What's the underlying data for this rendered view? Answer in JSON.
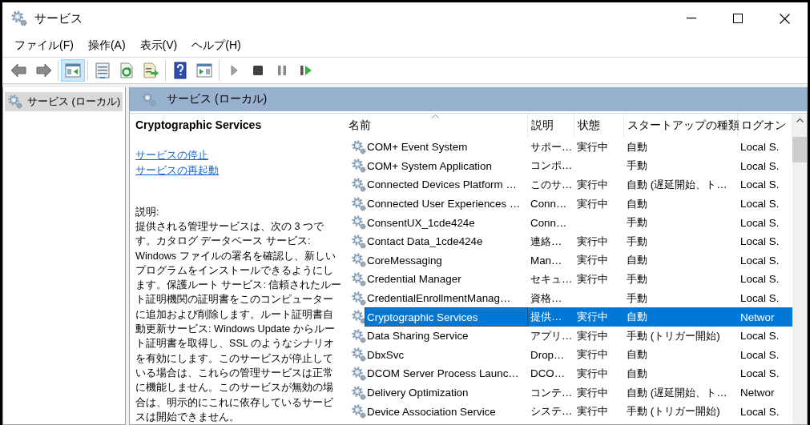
{
  "window": {
    "title": "サービス"
  },
  "menu": [
    {
      "label": "ファイル(F)"
    },
    {
      "label": "操作(A)"
    },
    {
      "label": "表示(V)"
    },
    {
      "label": "ヘルプ(H)"
    }
  ],
  "toolbar": [
    {
      "kind": "back",
      "pressed": false
    },
    {
      "kind": "forward",
      "pressed": false
    },
    {
      "kind": "sep"
    },
    {
      "kind": "tree",
      "pressed": true
    },
    {
      "kind": "sep"
    },
    {
      "kind": "properties",
      "pressed": false
    },
    {
      "kind": "refresh",
      "pressed": false
    },
    {
      "kind": "export",
      "pressed": false
    },
    {
      "kind": "sep"
    },
    {
      "kind": "help",
      "pressed": false
    },
    {
      "kind": "actionpane",
      "pressed": false
    },
    {
      "kind": "sep"
    },
    {
      "kind": "start",
      "pressed": false
    },
    {
      "kind": "stop",
      "pressed": false
    },
    {
      "kind": "pause",
      "pressed": false
    },
    {
      "kind": "resume",
      "pressed": false
    }
  ],
  "sidebar": {
    "items": [
      {
        "label": "サービス (ローカル)",
        "selected": true
      }
    ]
  },
  "panel": {
    "title": "サービス (ローカル)"
  },
  "details": {
    "service_name": "Cryptographic Services",
    "links": [
      "サービスの停止",
      "サービスの再起動"
    ],
    "description_label": "説明:",
    "description": "提供される管理サービスは、次の 3 つです。カタログ データベース サービス: Windows ファイルの署名を確認し、新しいプログラムをインストールできるようにします。保護ルート サービス: 信頼されたルート証明機関の証明書をこのコンピューターに追加および削除します。ルート証明書自動更新サービス: Windows Update からルート証明書を取得し、SSL のようなシナリオを有効にします。このサービスが停止している場合は、これらの管理サービスは正常に機能しません。このサービスが無効の場合は、明示的にこれに依存しているサービスは開始できません。"
  },
  "table": {
    "columns": [
      "名前",
      "説明",
      "状態",
      "スタートアップの種類",
      "ログオン"
    ],
    "rows": [
      {
        "cells": [
          "COM+ Event System",
          "サポー…",
          "実行中",
          "自動",
          "Local S."
        ],
        "selected": false
      },
      {
        "cells": [
          "COM+ System Application",
          "コンポ…",
          "",
          "手動",
          "Local S."
        ],
        "selected": false
      },
      {
        "cells": [
          "Connected Devices Platform …",
          "このサ…",
          "実行中",
          "自動 (遅延開始、ト…",
          "Local S."
        ],
        "selected": false
      },
      {
        "cells": [
          "Connected User Experiences …",
          "Conn…",
          "実行中",
          "自動",
          "Local S."
        ],
        "selected": false
      },
      {
        "cells": [
          "ConsentUX_1cde424e",
          "Conn…",
          "",
          "手動",
          "Local S."
        ],
        "selected": false
      },
      {
        "cells": [
          "Contact Data_1cde424e",
          "連絡…",
          "実行中",
          "手動",
          "Local S."
        ],
        "selected": false
      },
      {
        "cells": [
          "CoreMessaging",
          "Man…",
          "実行中",
          "自動",
          "Local S."
        ],
        "selected": false
      },
      {
        "cells": [
          "Credential Manager",
          "セキュ…",
          "実行中",
          "手動",
          "Local S."
        ],
        "selected": false
      },
      {
        "cells": [
          "CredentialEnrollmentManag…",
          "資格…",
          "",
          "手動",
          "Local S."
        ],
        "selected": false
      },
      {
        "cells": [
          "Cryptographic Services",
          "提供…",
          "実行中",
          "自動",
          "Networ"
        ],
        "selected": true
      },
      {
        "cells": [
          "Data Sharing Service",
          "アプリ…",
          "実行中",
          "手動 (トリガー開始)",
          "Local S."
        ],
        "selected": false
      },
      {
        "cells": [
          "DbxSvc",
          "Drop…",
          "実行中",
          "自動",
          "Local S."
        ],
        "selected": false
      },
      {
        "cells": [
          "DCOM Server Process Launc…",
          "DCO…",
          "実行中",
          "自動",
          "Local S."
        ],
        "selected": false
      },
      {
        "cells": [
          "Delivery Optimization",
          "コンテ…",
          "実行中",
          "自動 (遅延開始、ト…",
          "Networ"
        ],
        "selected": false
      },
      {
        "cells": [
          "Device Association Service",
          "システ…",
          "実行中",
          "手動 (トリガー開始)",
          "Local S."
        ],
        "selected": false
      }
    ]
  }
}
